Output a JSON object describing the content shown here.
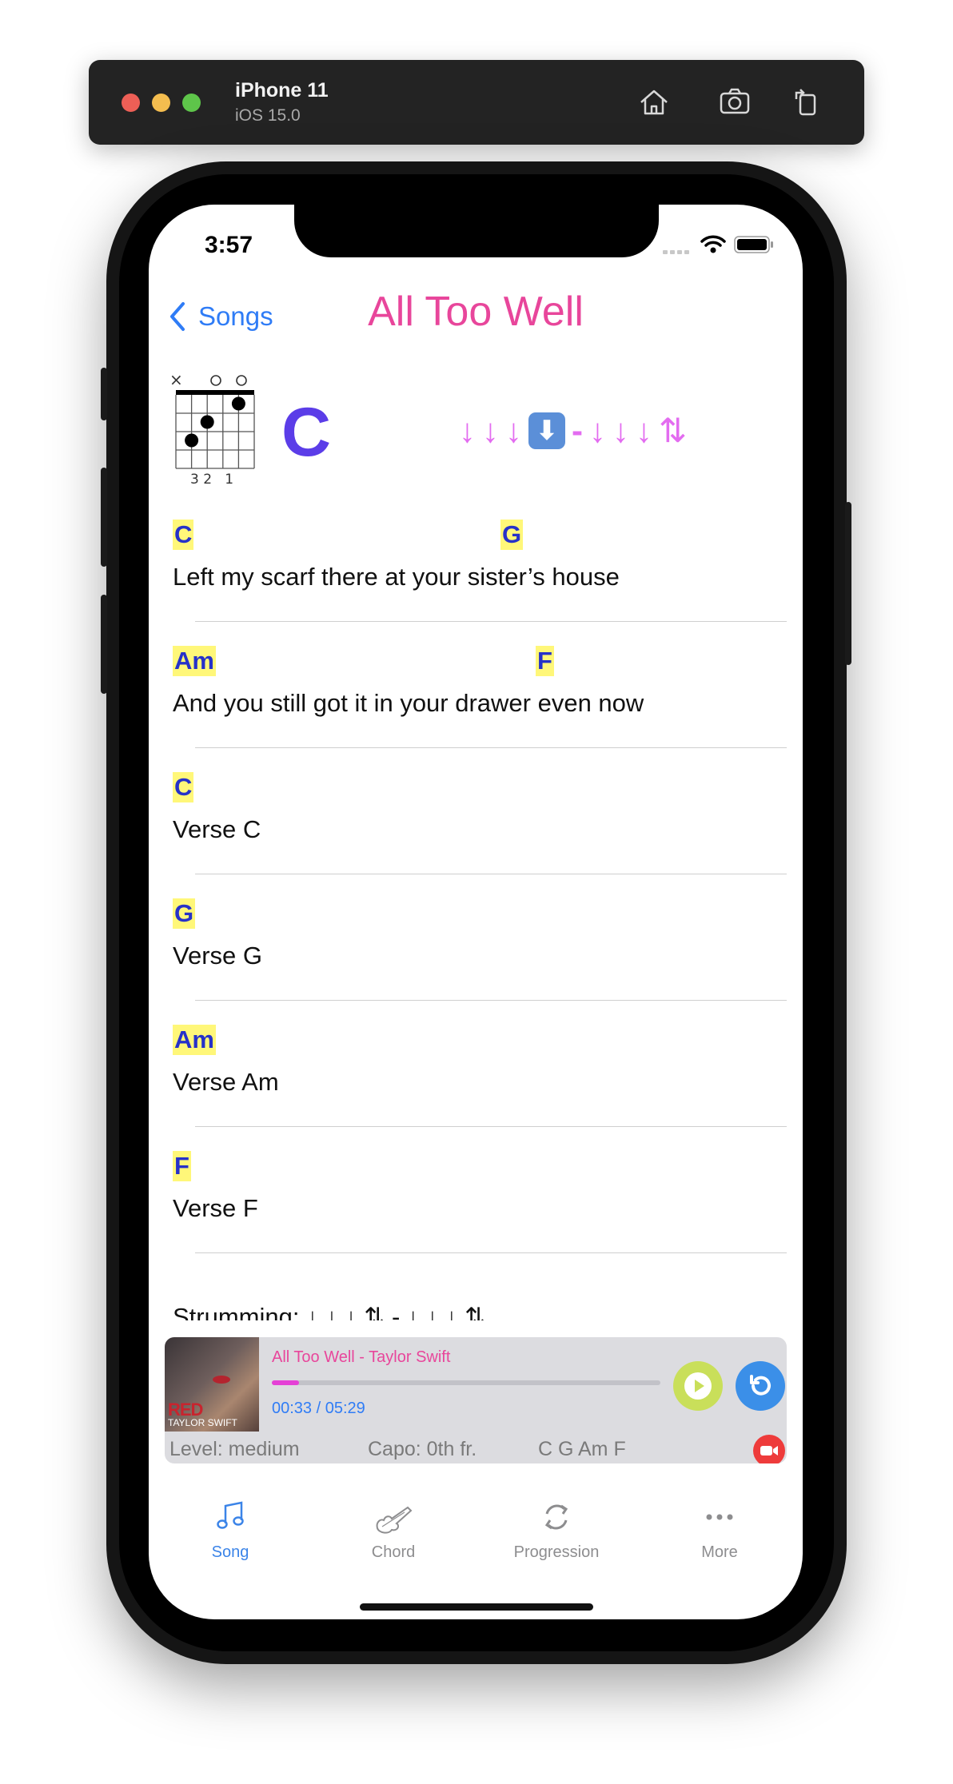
{
  "simulator": {
    "device_name": "iPhone 11",
    "os_version": "iOS 15.0"
  },
  "status_bar": {
    "time": "3:57"
  },
  "nav": {
    "back_label": "Songs",
    "title": "All Too Well"
  },
  "chord_diagram": {
    "chord": "C",
    "fingering": "3 2   1"
  },
  "strum_pattern": {
    "down": "↓",
    "accent": "⬇",
    "rest": "-",
    "updown": "⇅"
  },
  "lines": [
    {
      "chords": [
        {
          "name": "C"
        },
        {
          "name": "G"
        }
      ],
      "lyric": "Left my scarf there at your sister’s house"
    },
    {
      "chords": [
        {
          "name": "Am"
        },
        {
          "name": "F"
        }
      ],
      "lyric": "And you still got it in your drawer even now"
    },
    {
      "chords": [
        {
          "name": "C"
        }
      ],
      "lyric": "Verse C"
    },
    {
      "chords": [
        {
          "name": "G"
        }
      ],
      "lyric": "Verse G"
    },
    {
      "chords": [
        {
          "name": "Am"
        }
      ],
      "lyric": "Verse Am"
    },
    {
      "chords": [
        {
          "name": "F"
        }
      ],
      "lyric": "Verse F"
    }
  ],
  "strumming_text": "Strumming: ↓ ↓ ↓ ⇅ - ↓ ↓ ↓ ⇅",
  "player": {
    "track": "All Too Well - Taylor Swift",
    "time": "00:33 / 05:29",
    "progress": 0.07,
    "cover_title": "RED",
    "cover_artist": "TAYLOR SWIFT",
    "level": "Level: medium",
    "capo": "Capo: 0th fr.",
    "chords": "C G Am F"
  },
  "tabs": [
    {
      "label": "Song",
      "icon": "music-note-icon",
      "active": true
    },
    {
      "label": "Chord",
      "icon": "guitar-icon",
      "active": false
    },
    {
      "label": "Progression",
      "icon": "cycle-icon",
      "active": false
    },
    {
      "label": "More",
      "icon": "ellipsis-icon",
      "active": false
    }
  ],
  "colors": {
    "accent": "#2f7cf6",
    "title": "#e8469b",
    "chord_highlight": "#fff779",
    "chord_text": "#2631c9",
    "strum": "#e36cf0"
  }
}
